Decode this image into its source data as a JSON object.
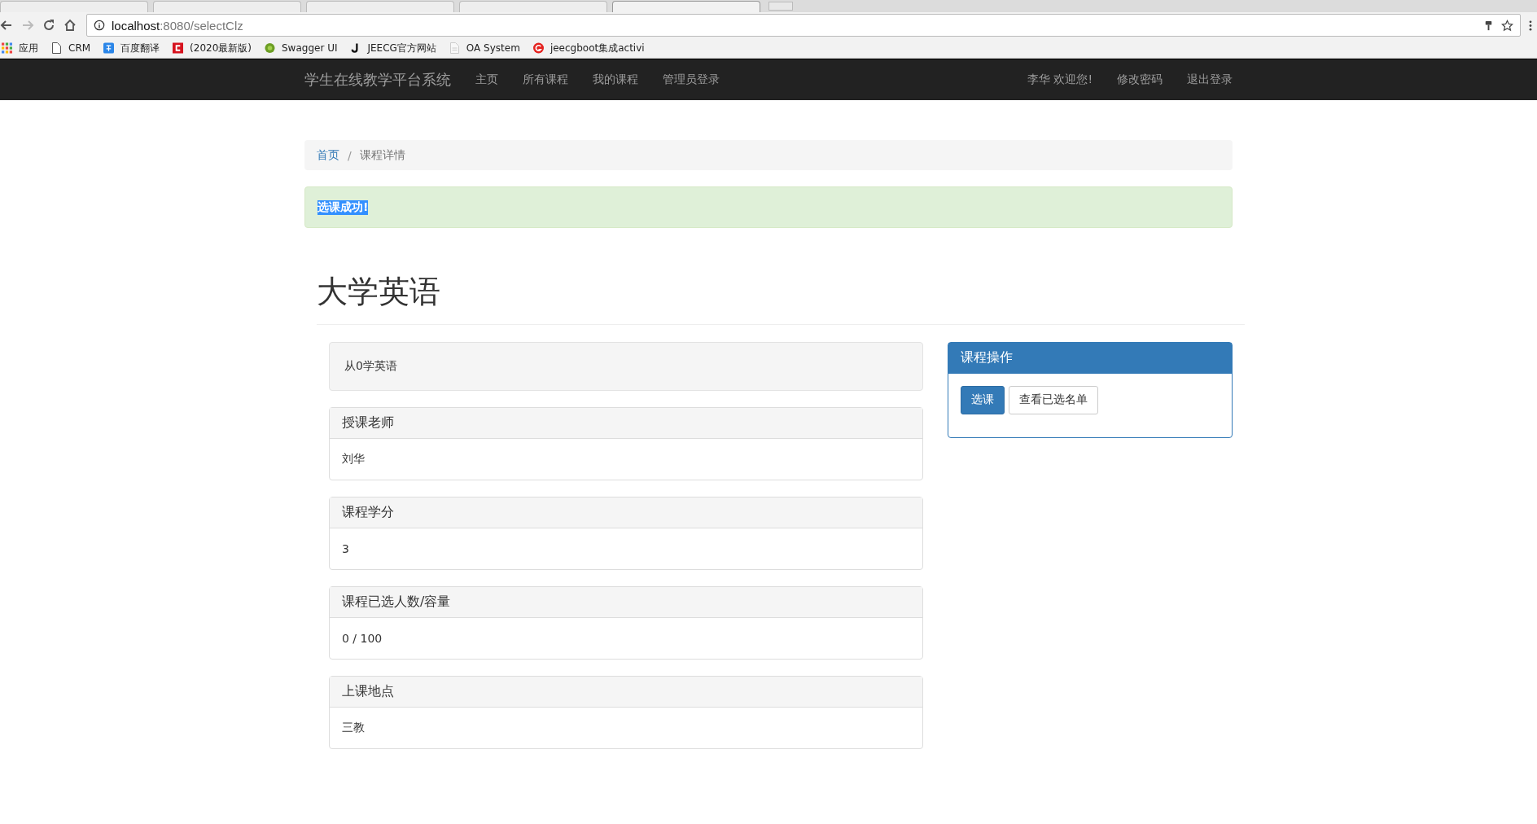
{
  "browser": {
    "tabs": [
      {
        "selected": false
      },
      {
        "selected": false
      },
      {
        "selected": false
      },
      {
        "selected": false
      },
      {
        "selected": true
      }
    ],
    "address": {
      "host": "localhost",
      "rest": ":8080/selectClz"
    },
    "bookmarks": [
      {
        "label": "应用",
        "kind": "apps"
      },
      {
        "label": "CRM",
        "kind": "page"
      },
      {
        "label": "百度翻译",
        "kind": "translate"
      },
      {
        "label": "(2020最新版)",
        "kind": "red"
      },
      {
        "label": "Swagger UI",
        "kind": "swagger"
      },
      {
        "label": "JEECG官方网站",
        "kind": "j"
      },
      {
        "label": "OA System",
        "kind": "doc"
      },
      {
        "label": "jeecgboot集成activi",
        "kind": "g"
      }
    ]
  },
  "navbar": {
    "brand": "学生在线教学平台系统",
    "links": [
      "主页",
      "所有课程",
      "我的课程",
      "管理员登录"
    ],
    "right": [
      "李华 欢迎您!",
      "修改密码",
      "退出登录"
    ]
  },
  "breadcrumb": {
    "link": "首页",
    "separator": "/",
    "current": "课程详情"
  },
  "alert": {
    "text": "选课成功!",
    "highlighted": true
  },
  "course": {
    "title": "大学英语",
    "description": "从0学英语",
    "fields": [
      {
        "heading": "授课老师",
        "value": "刘华"
      },
      {
        "heading": "课程学分",
        "value": "3"
      },
      {
        "heading": "课程已选人数/容量",
        "value": "0 / 100"
      },
      {
        "heading": "上课地点",
        "value": "三教"
      }
    ]
  },
  "actions": {
    "heading": "课程操作",
    "buttons": [
      {
        "label": "选课",
        "kind": "primary"
      },
      {
        "label": "查看已选名单",
        "kind": "default"
      }
    ]
  }
}
